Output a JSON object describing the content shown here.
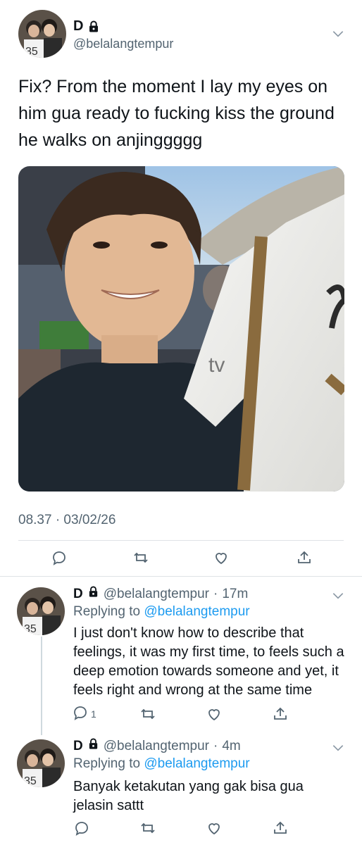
{
  "main_tweet": {
    "display_name": "D",
    "handle": "@belalangtempur",
    "text": "Fix? From the moment I lay my eyes on him gua ready to fucking kiss the ground he walks on anjinggggg",
    "timestamp": "08.37 · 03/02/26",
    "photo_jersey_text": "tv"
  },
  "replies": [
    {
      "display_name": "D",
      "handle": "@belalangtempur",
      "time": "17m",
      "replying_label": "Replying to",
      "replying_to": "@belalangtempur",
      "text": "I just don't know how to describe that feelings, it was my first time, to feels such a deep emotion towards someone and yet, it feels right and wrong at the same time",
      "reply_count": "1"
    },
    {
      "display_name": "D",
      "handle": "@belalangtempur",
      "time": "4m",
      "replying_label": "Replying to",
      "replying_to": "@belalangtempur",
      "text": "Banyak ketakutan yang gak bisa gua jelasin sattt",
      "reply_count": ""
    }
  ],
  "colors": {
    "accent": "#1d9bf0",
    "muted": "#536471",
    "divider": "#dfe3e6"
  },
  "icons": [
    "lock-icon",
    "chevron-down-icon",
    "reply-icon",
    "retweet-icon",
    "like-icon",
    "share-icon"
  ]
}
